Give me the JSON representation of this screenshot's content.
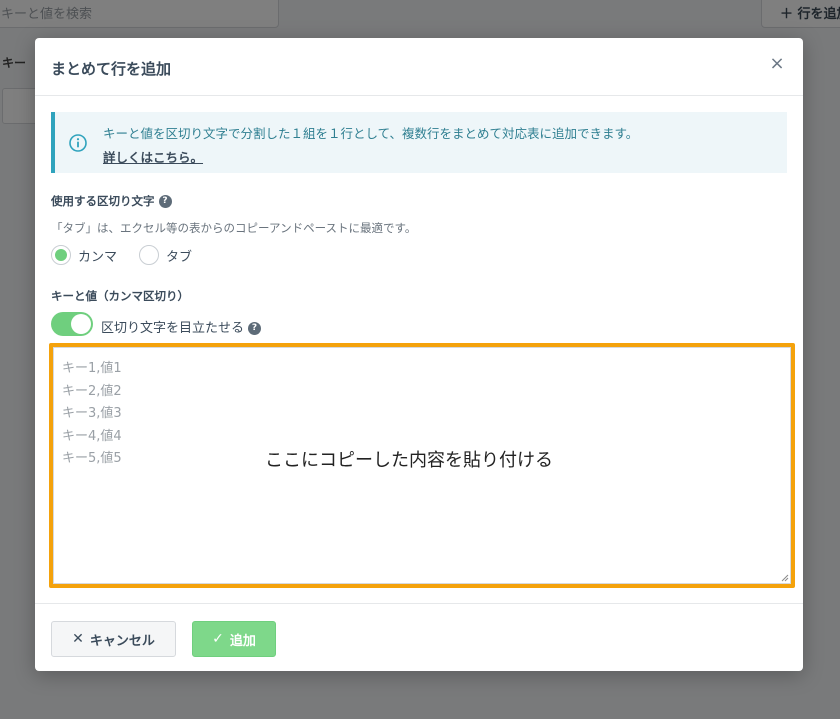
{
  "background": {
    "search_placeholder": "キーと値を検索",
    "add_row_button": "＋ 行を追加",
    "key_label": "キー"
  },
  "modal": {
    "title": "まとめて行を追加",
    "close_symbol": "×",
    "info": {
      "text": "キーと値を区切り文字で分割した１組を１行として、複数行をまとめて対応表に追加できます。",
      "link": "詳しくはこちら。"
    },
    "delimiter_section": {
      "label": "使用する区切り文字",
      "hint": "「タブ」は、エクセル等の表からのコピーアンドペーストに最適です。",
      "options": [
        {
          "label": "カンマ",
          "checked": true
        },
        {
          "label": "タブ",
          "checked": false
        }
      ]
    },
    "kv_section": {
      "label": "キーと値（カンマ区切り）",
      "toggle_label": "区切り文字を目立たせる",
      "toggle_on": true,
      "textarea_placeholder": "キー1,値1\nキー2,値2\nキー3,値3\nキー4,値4\nキー5,値5"
    },
    "annotation": "ここにコピーした内容を貼り付ける",
    "footer": {
      "cancel_label": "キャンセル",
      "add_label": "追加"
    }
  },
  "colors": {
    "accent_green": "#6fcf7e",
    "info_teal": "#2fa3bd",
    "highlight_orange": "#f4a20c"
  }
}
